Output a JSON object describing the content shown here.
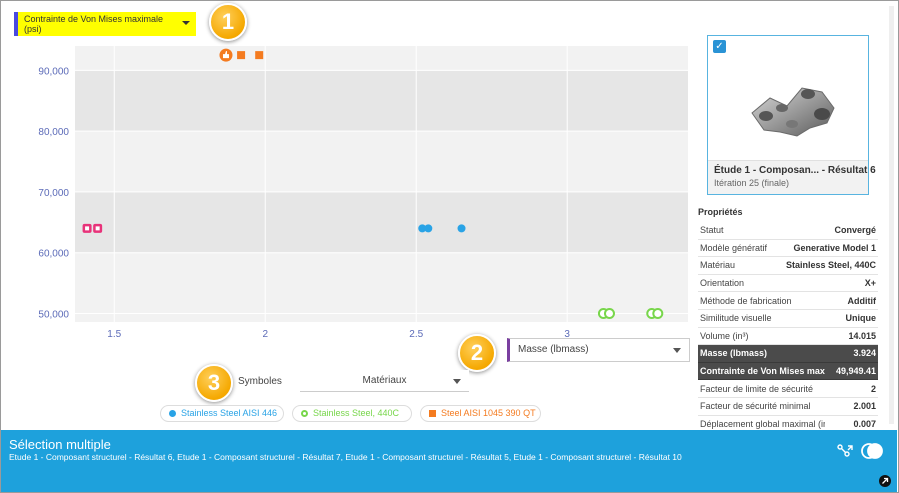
{
  "y_selector": {
    "label": "Contrainte de Von Mises maximale (psi)"
  },
  "x_selector": {
    "label": "Masse (lbmass)"
  },
  "symbols": {
    "label": "Symboles",
    "value": "Matériaux"
  },
  "callouts": [
    "1",
    "2",
    "3"
  ],
  "colors": {
    "blue": "#29a3e6",
    "green": "#78d64b",
    "orange": "#f47b20",
    "pink": "#e8337a",
    "accent_bar": "#1ea1dc",
    "highlight": "#ffff00"
  },
  "legend": [
    {
      "label": "Stainless Steel AISI 446",
      "color": "#29a3e6",
      "symbol": "filled-circle"
    },
    {
      "label": "Stainless Steel, 440C",
      "color": "#78d64b",
      "symbol": "ring"
    },
    {
      "label": "Steel AISI 1045 390 QT",
      "color": "#f47b20",
      "symbol": "square"
    }
  ],
  "chart_data": {
    "type": "scatter",
    "xlabel": "Masse (lbmass)",
    "ylabel": "Contrainte de Von Mises maximale (psi)",
    "xlim": [
      1.37,
      3.4
    ],
    "ylim": [
      48600,
      94000
    ],
    "x_ticks": [
      1.5,
      2,
      2.5,
      3
    ],
    "x_tick_labels": [
      "1.5",
      "2",
      "2.5",
      "3"
    ],
    "y_ticks": [
      50000,
      60000,
      70000,
      80000,
      90000
    ],
    "y_tick_labels": [
      "50,000",
      "60,000",
      "70,000",
      "80,000",
      "90,000"
    ],
    "grid": true,
    "series": [
      {
        "name": "Stainless Steel AISI 446",
        "symbol": "filled-circle",
        "color": "#29a3e6",
        "points": [
          [
            2.52,
            64000
          ],
          [
            2.54,
            64000
          ],
          [
            2.65,
            64000
          ]
        ]
      },
      {
        "name": "Stainless Steel, 440C",
        "symbol": "ring",
        "color": "#78d64b",
        "points": [
          [
            3.12,
            50000
          ],
          [
            3.14,
            50000
          ],
          [
            3.28,
            50000
          ],
          [
            3.3,
            50000
          ]
        ]
      },
      {
        "name": "Steel AISI 1045 390 QT",
        "symbol": "square",
        "color": "#f47b20",
        "points": [
          [
            1.92,
            92500
          ],
          [
            1.98,
            92500
          ]
        ]
      },
      {
        "symbol": "liked",
        "color": "#f47b20",
        "points": [
          [
            1.87,
            92500
          ]
        ]
      },
      {
        "symbol": "pink-badge",
        "color": "#e8337a",
        "points": [
          [
            1.41,
            64000
          ],
          [
            1.445,
            64000
          ]
        ]
      }
    ]
  },
  "result_card": {
    "title": "Étude 1 - Composan... - Résultat 6",
    "subtitle": "Itération 25 (finale)",
    "selected_glyph": "✓"
  },
  "properties": {
    "title": "Propriétés",
    "rows": [
      {
        "key": "Statut",
        "value": "Convergé"
      },
      {
        "key": "Modèle génératif",
        "value": "Generative Model 1"
      },
      {
        "key": "Matériau",
        "value": "Stainless Steel, 440C"
      },
      {
        "key": "Orientation",
        "value": "X+"
      },
      {
        "key": "Méthode de fabrication",
        "value": "Additif"
      },
      {
        "key": "Similitude visuelle",
        "value": "Unique"
      },
      {
        "key": "Volume (in³)",
        "value": "14.015"
      },
      {
        "key": "Masse (lbmass)",
        "value": "3.924",
        "highlight": true
      },
      {
        "key": "Contrainte de Von Mises maxima...",
        "value": "49,949.41",
        "highlight": true
      },
      {
        "key": "Facteur de limite de sécurité",
        "value": "2"
      },
      {
        "key": "Facteur de sécurité minimal",
        "value": "2.001"
      },
      {
        "key": "Déplacement global maximal (in)",
        "value": "0.007"
      }
    ]
  },
  "selection": {
    "title": "Sélection multiple",
    "items": "Etude 1 - Composant structurel - Résultat 6, Etude 1 - Composant structurel - Résultat 7, Etude 1 - Composant structurel - Résultat 5, Etude 1 - Composant structurel - Résultat 10"
  }
}
